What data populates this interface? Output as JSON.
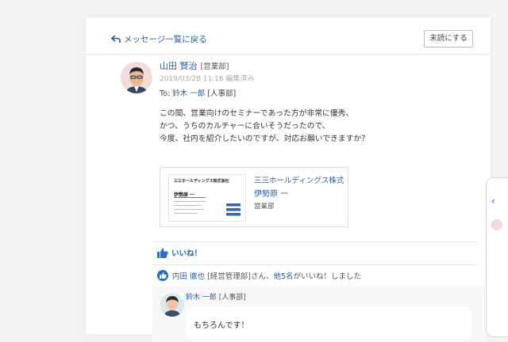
{
  "nav": {
    "back_label": "メッセージ一覧に戻る",
    "unread_button": "未読にする"
  },
  "post": {
    "author_name": "山田 賢治",
    "author_dept": "[営業部]",
    "timestamp": "2019/03/28 11:16 編集済み",
    "to_prefix": "To: ",
    "to_name": "鈴木 一郎",
    "to_dept": "[人事部]",
    "body_lines": [
      "この間、営業向けのセミナーであった方が非常に優秀、",
      "かつ、うちのカルチャーに合いそうだったので、",
      "今度、社内を紹介したいのですが、対応お願いできますか？"
    ]
  },
  "business_card": {
    "thumb_company": "三三ホールディングス株式会社",
    "thumb_name": "伊勢原 一",
    "company": "三三ホールディングス株式…",
    "name": "伊勢原 一",
    "dept": "営業部"
  },
  "like": {
    "label": "いいね！",
    "liker_name": "内田 徹也",
    "liker_dept": "[経営管理部]",
    "suffix1": " さん、",
    "others": "他5名",
    "suffix2": "がいいね！しました"
  },
  "comment": {
    "author_name": "鈴木 一郎",
    "author_dept": "[人事部]",
    "text": "もちろんです！"
  },
  "colors": {
    "accent": "#2a5d9f",
    "like_blue": "#2a6fc4"
  }
}
